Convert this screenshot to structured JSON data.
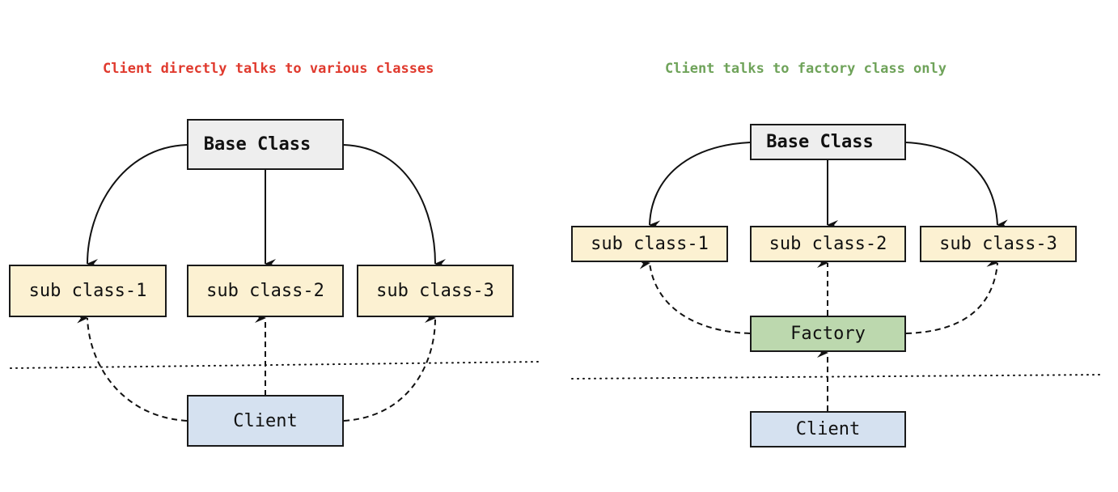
{
  "colors": {
    "title_left": "#e03a2e",
    "title_right": "#6fa35a",
    "base_fill": "#eeeeee",
    "sub_fill": "#fcf1d2",
    "client_fill": "#d5e1f0",
    "factory_fill": "#bcd8ae",
    "stroke": "#1a1a1a"
  },
  "left_diagram": {
    "title": "Client directly talks to various classes",
    "base": "Base Class",
    "subs": [
      "sub class-1",
      "sub class-2",
      "sub class-3"
    ],
    "client": "Client"
  },
  "right_diagram": {
    "title": "Client talks to factory class only",
    "base": "Base Class",
    "subs": [
      "sub class-1",
      "sub class-2",
      "sub class-3"
    ],
    "factory": "Factory",
    "client": "Client"
  }
}
